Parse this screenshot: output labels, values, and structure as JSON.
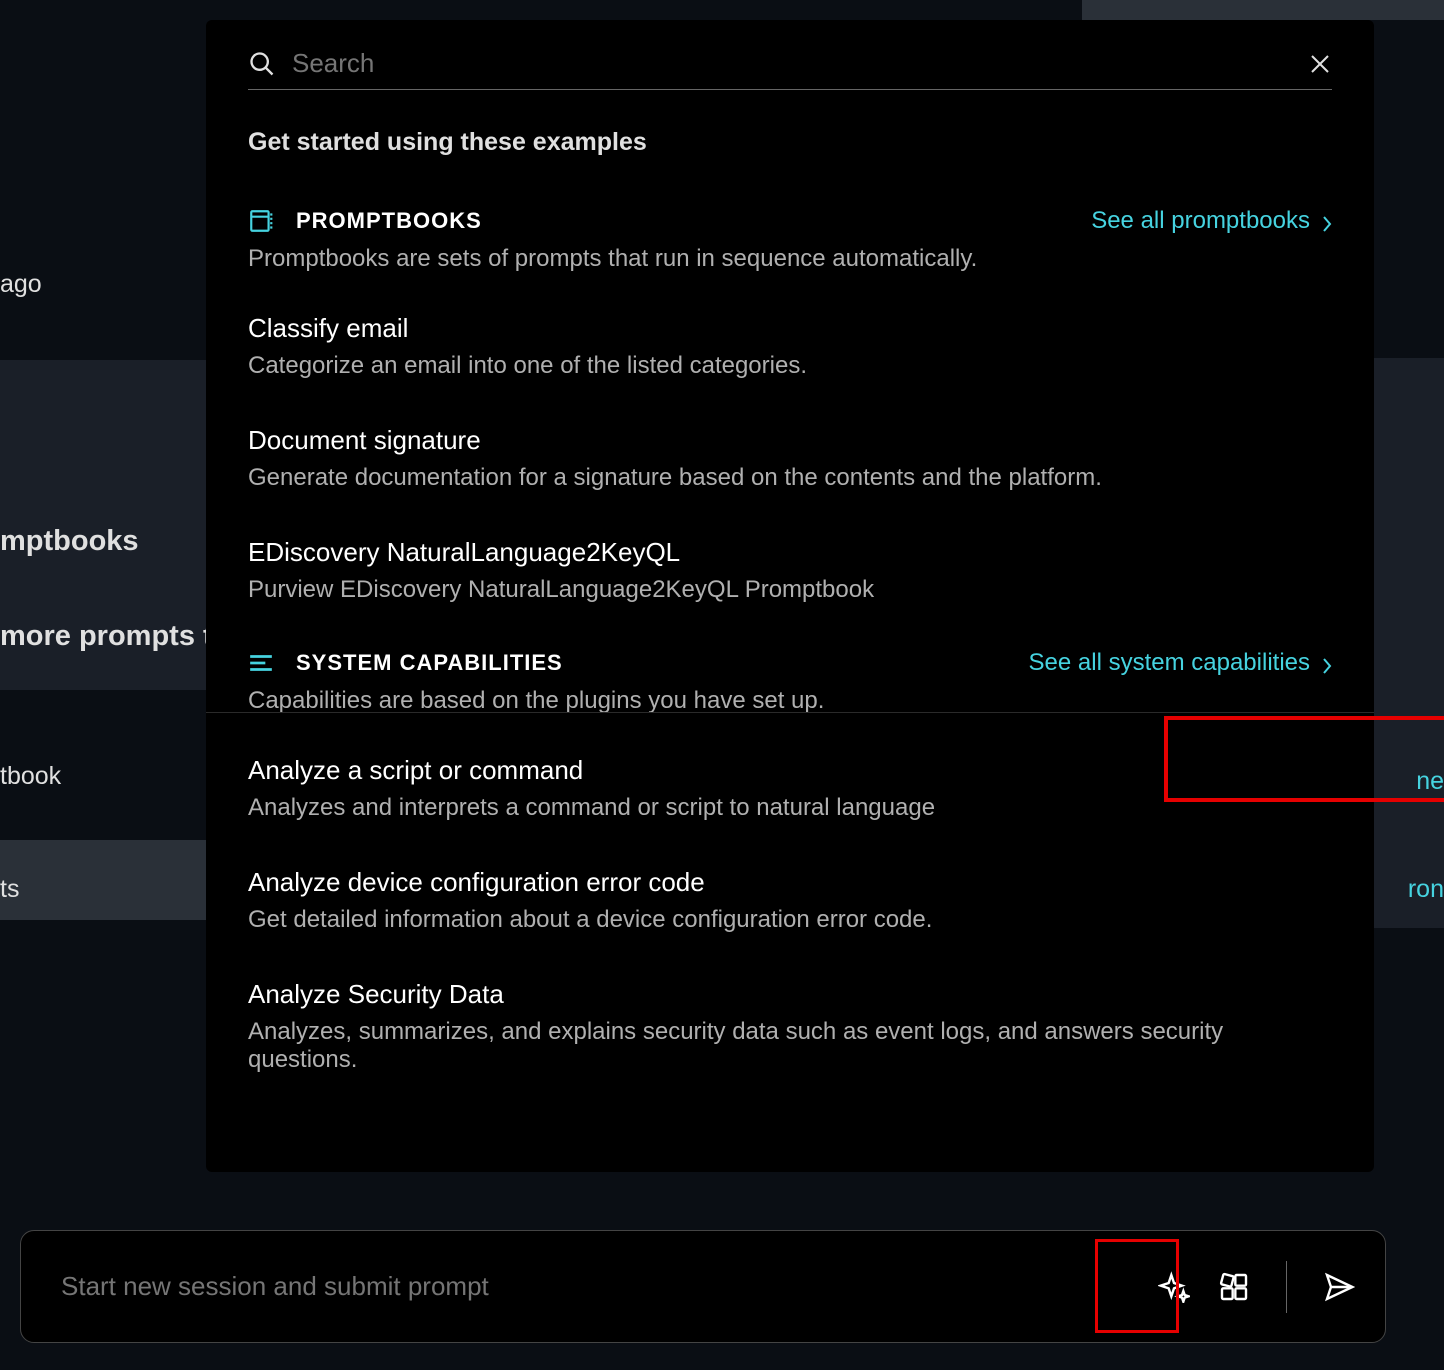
{
  "background": {
    "ago": "ago",
    "mptbooks": "mptbooks",
    "more_prompts": " more prompts tl",
    "tbook": "tbook",
    "ts": "ts",
    "ne": "ne",
    "ron": "ron"
  },
  "popup": {
    "search_placeholder": "Search",
    "intro": "Get started using these examples",
    "promptbooks": {
      "title": "PROMPTBOOKS",
      "see_all": "See all promptbooks",
      "description": "Promptbooks are sets of prompts that run in sequence automatically.",
      "items": [
        {
          "title": "Classify email",
          "desc": "Categorize an email into one of the listed categories."
        },
        {
          "title": "Document signature",
          "desc": "Generate documentation for a signature based on the contents and the platform."
        },
        {
          "title": "EDiscovery NaturalLanguage2KeyQL",
          "desc": "Purview EDiscovery NaturalLanguage2KeyQL Promptbook"
        }
      ]
    },
    "capabilities": {
      "title": "SYSTEM CAPABILITIES",
      "see_all": "See all system capabilities",
      "description": "Capabilities are based on the plugins you have set up.",
      "items": [
        {
          "title": "Analyze a script or command",
          "desc": "Analyzes and interprets a command or script to natural language"
        },
        {
          "title": "Analyze device configuration error code",
          "desc": "Get detailed information about a device configuration error code."
        },
        {
          "title": "Analyze Security Data",
          "desc": "Analyzes, summarizes, and explains security data such as event logs, and answers security questions."
        }
      ]
    }
  },
  "prompt_bar": {
    "placeholder": "Start new session and submit prompt"
  },
  "colors": {
    "accent": "#46d3e0",
    "highlight": "#e60000"
  }
}
